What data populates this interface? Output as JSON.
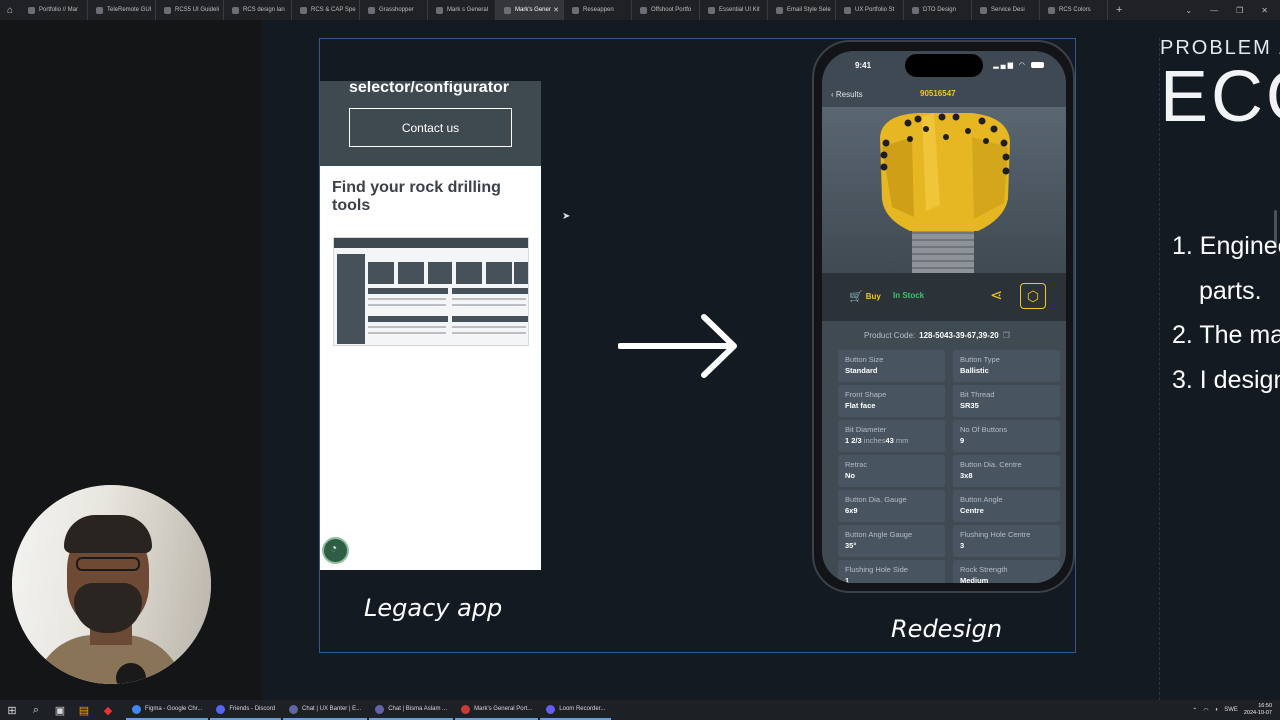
{
  "browser": {
    "tabs": [
      {
        "label": "Portfolio // Mar",
        "active": false
      },
      {
        "label": "TeleRemote GUI",
        "active": false
      },
      {
        "label": "RCS5 UI Guideli",
        "active": false
      },
      {
        "label": "RCS design lan",
        "active": false
      },
      {
        "label": "RCS & CAP Spe",
        "active": false
      },
      {
        "label": "Grasshopper",
        "active": false
      },
      {
        "label": "Mark s General",
        "active": false
      },
      {
        "label": "Mark's Gener",
        "active": true
      },
      {
        "label": "Reseappen",
        "active": false
      },
      {
        "label": "Offshoot Portfo",
        "active": false
      },
      {
        "label": "Essential UI Kit",
        "active": false
      },
      {
        "label": "Email Style Sele",
        "active": false
      },
      {
        "label": "UX Portfolio St",
        "active": false
      },
      {
        "label": "DTO Design",
        "active": false
      },
      {
        "label": "Service Desi",
        "active": false
      },
      {
        "label": "RCS Colors",
        "active": false
      }
    ],
    "new_tab": "+",
    "close_tab": "✕",
    "window_controls": [
      "⌄",
      "—",
      "❐",
      "✕"
    ]
  },
  "legacy": {
    "heading_cut": "selector/configurator",
    "contact_label": "Contact us",
    "find_heading": "Find your rock drilling tools",
    "caption": "Legacy app"
  },
  "redesign": {
    "caption": "Redesign",
    "time": "9:41",
    "back_label": "Results",
    "header_code": "90516547",
    "buy_label": "Buy",
    "stock_label": "In Stock",
    "product_code_label": "Product Code:",
    "product_code": "128-5043-39-67,39-20",
    "specs": [
      {
        "label": "Button Size",
        "value": "Standard"
      },
      {
        "label": "Button Type",
        "value": "Ballistic"
      },
      {
        "label": "Front Shape",
        "value": "Flat face"
      },
      {
        "label": "Bit Thread",
        "value": "SR35"
      },
      {
        "label": "Bit Diameter",
        "value": "1 2/3",
        "unit1": "inches",
        "value2": "43",
        "unit2": "mm"
      },
      {
        "label": "No Of Buttons",
        "value": "9"
      },
      {
        "label": "Retrac",
        "value": "No"
      },
      {
        "label": "Button Dia. Centre",
        "value": "3x8"
      },
      {
        "label": "Button Dia. Gauge",
        "value": "6x9"
      },
      {
        "label": "Button Angle",
        "value": "Centre"
      },
      {
        "label": "Button Angle Gauge",
        "value": "35°"
      },
      {
        "label": "Flushing Hole Centre",
        "value": "3"
      },
      {
        "label": "Flushing Hole Side",
        "value": "1"
      },
      {
        "label": "Rock Strength",
        "value": "Medium"
      }
    ]
  },
  "slide": {
    "problem_heading": "PROBLEM /",
    "big_word": "ECO",
    "list": [
      "1. Enginee",
      "parts.",
      "2. The ma",
      "3. I design"
    ]
  },
  "taskbar": {
    "apps": [
      {
        "label": "Figma - Google Chr...",
        "color": "#4285f4"
      },
      {
        "label": "Friends - Discord",
        "color": "#5865f2"
      },
      {
        "label": "Chat | UX Banter | E...",
        "color": "#6264a7"
      },
      {
        "label": "Chat | Bisma Aslam ...",
        "color": "#6264a7"
      },
      {
        "label": "Mark's General Port...",
        "color": "#c93b3b"
      },
      {
        "label": "Loom Recorder...",
        "color": "#625df5"
      }
    ],
    "lang": "SWE",
    "time": "16:50",
    "date": "2024-10-07"
  },
  "colors": {
    "accent_yellow": "#f3c625",
    "stock_green": "#3cc26b",
    "frame_blue": "#2f5a87"
  }
}
